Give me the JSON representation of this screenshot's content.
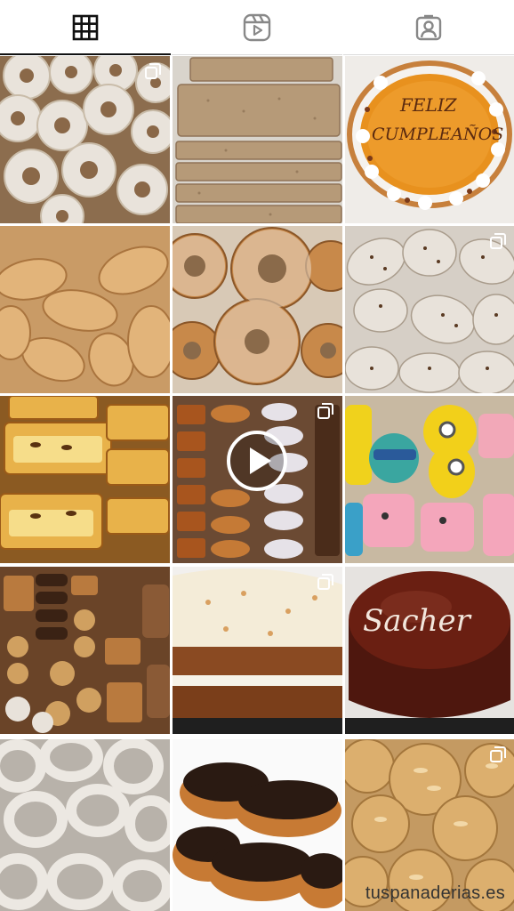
{
  "tabs": [
    {
      "icon": "grid-icon",
      "active": true
    },
    {
      "icon": "reels-icon",
      "active": false
    },
    {
      "icon": "tagged-icon",
      "active": false
    }
  ],
  "posts": [
    {
      "subject": "rosquillas",
      "multi": true,
      "video": false
    },
    {
      "subject": "biscuit bars",
      "multi": false,
      "video": false
    },
    {
      "subject": "birthday cake",
      "multi": false,
      "video": false,
      "cake_text": "FELIZ CUMPLEAÑOS"
    },
    {
      "subject": "croissants",
      "multi": false,
      "video": false
    },
    {
      "subject": "sugar donuts",
      "multi": false,
      "video": false
    },
    {
      "subject": "chocolate croissants",
      "multi": true,
      "video": false
    },
    {
      "subject": "custard pastries",
      "multi": false,
      "video": false
    },
    {
      "subject": "assorted pastries",
      "multi": true,
      "video": true
    },
    {
      "subject": "character cookies",
      "multi": false,
      "video": false
    },
    {
      "subject": "mini pastries",
      "multi": false,
      "video": false
    },
    {
      "subject": "carrot cake",
      "multi": true,
      "video": false
    },
    {
      "subject": "sacher cake",
      "multi": false,
      "video": false,
      "cake_text": "Sacher"
    },
    {
      "subject": "glazed rings",
      "multi": false,
      "video": false
    },
    {
      "subject": "chocolate eclairs",
      "multi": false,
      "video": false
    },
    {
      "subject": "almond cookies",
      "multi": true,
      "video": false
    }
  ],
  "watermark": "tuspanaderias.es"
}
